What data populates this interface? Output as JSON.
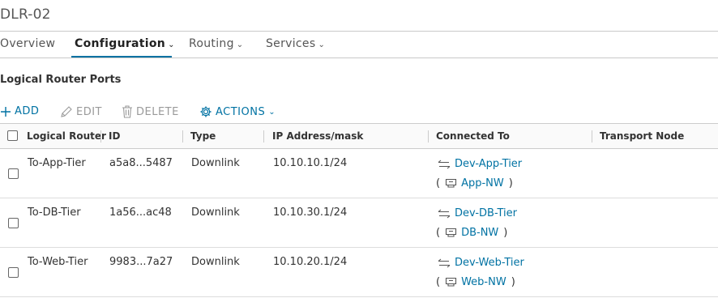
{
  "window": {
    "title": "DLR-02"
  },
  "tabs": [
    {
      "label": "Overview",
      "has_dropdown": false,
      "active": false
    },
    {
      "label": "Configuration",
      "has_dropdown": true,
      "active": true
    },
    {
      "label": "Routing",
      "has_dropdown": true,
      "active": false
    },
    {
      "label": "Services",
      "has_dropdown": true,
      "active": false
    }
  ],
  "section_title": "Logical Router Ports",
  "toolbar": {
    "add_label": "ADD",
    "edit_label": "EDIT",
    "delete_label": "DELETE",
    "actions_label": "ACTIONS"
  },
  "table": {
    "columns": [
      "Logical Router",
      "ID",
      "Type",
      "IP Address/mask",
      "Connected To",
      "Transport Node"
    ],
    "rows": [
      {
        "name": "To-App-Tier",
        "id": "a5a8...5487",
        "type": "Downlink",
        "ip": "10.10.10.1/24",
        "connected_port": "Dev-App-Tier",
        "connected_switch": "App-NW",
        "transport_node": ""
      },
      {
        "name": "To-DB-Tier",
        "id": "1a56...ac48",
        "type": "Downlink",
        "ip": "10.10.30.1/24",
        "connected_port": "Dev-DB-Tier",
        "connected_switch": "DB-NW",
        "transport_node": ""
      },
      {
        "name": "To-Web-Tier",
        "id": "9983...7a27",
        "type": "Downlink",
        "ip": "10.10.20.1/24",
        "connected_port": "Dev-Web-Tier",
        "connected_switch": "Web-NW",
        "transport_node": ""
      }
    ]
  },
  "colors": {
    "accent": "#0072a3",
    "disabled": "#9a9a9a",
    "border": "#cccccc"
  }
}
